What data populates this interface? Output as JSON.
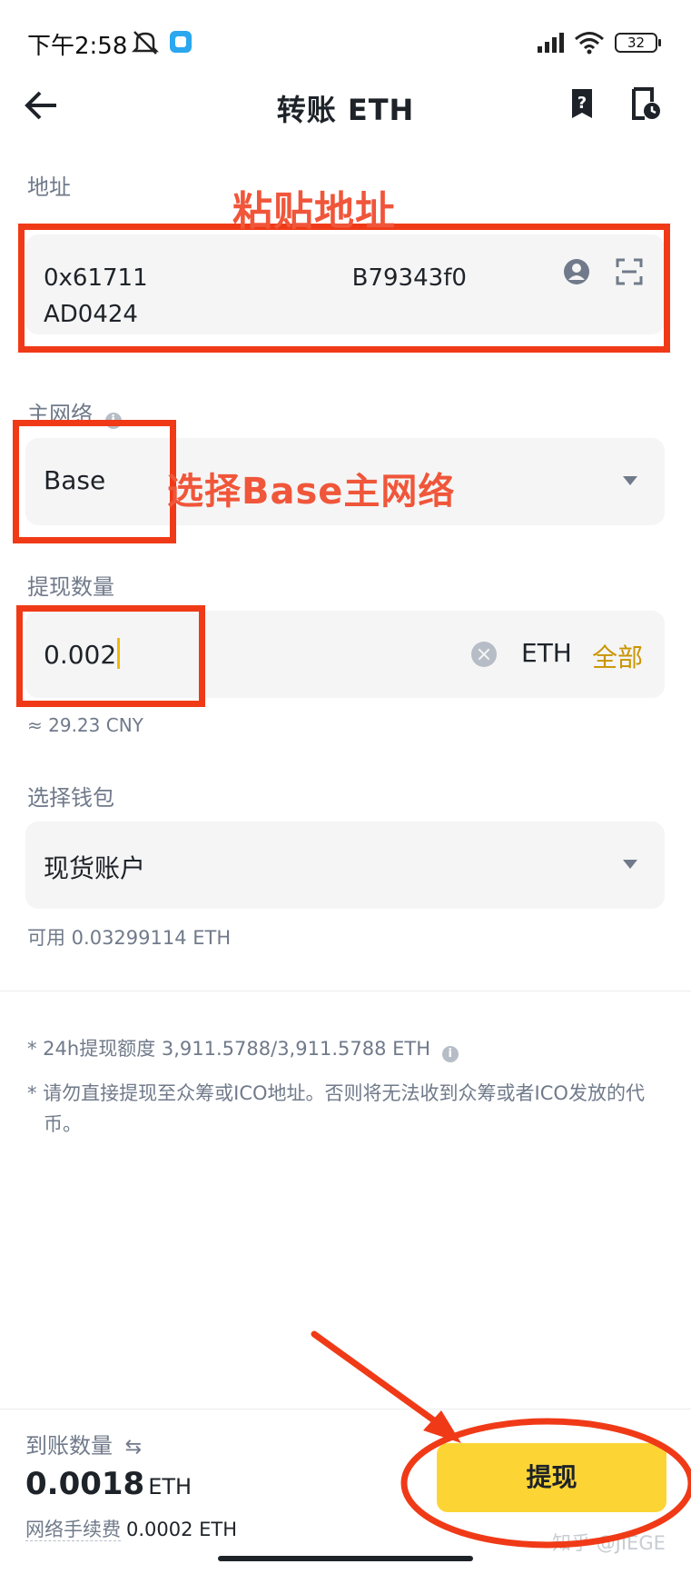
{
  "status_bar": {
    "time": "下午2:58",
    "battery": "32",
    "icons": [
      "mute-icon",
      "app-notification-icon",
      "signal-icon",
      "wifi-icon",
      "battery-icon"
    ]
  },
  "header": {
    "title": "转账 ETH",
    "back_icon": "arrow-left-icon",
    "help_icon": "help-icon",
    "history_icon": "history-icon"
  },
  "address": {
    "label": "地址",
    "value": "0x6171 B79343f0 AD0424",
    "contact_icon": "contact-icon",
    "scan_icon": "scan-icon"
  },
  "network": {
    "label": "主网络",
    "value": "Base",
    "info_icon": "info-icon"
  },
  "amount": {
    "label": "提现数量",
    "value": "0.002",
    "unit": "ETH",
    "max_label": "全部",
    "fiat_estimate": "≈ 29.23 CNY"
  },
  "wallet": {
    "label": "选择钱包",
    "value": "现货账户",
    "available": "可用 0.03299114 ETH"
  },
  "notes": {
    "quota": "* 24h提现额度 3,911.5788/3,911.5788 ETH",
    "ico_warning": "* 请勿直接提现至众筹或ICO地址。否则将无法收到众筹或者ICO发放的代币。"
  },
  "bottom": {
    "receive_label": "到账数量",
    "receive_amount": "0.0018",
    "receive_unit": "ETH",
    "fee_label": "网络手续费",
    "fee_value": "0.0002 ETH",
    "withdraw_button": "提现"
  },
  "annotations": {
    "paste_address": "粘贴地址",
    "select_network": "选择Base主网络"
  },
  "watermark": "知乎 @JIEGE",
  "colors": {
    "accent": "#fcd535",
    "accent_text": "#c99400",
    "annotation": "#f03a17",
    "panel_bg": "#f5f5f5",
    "muted_text": "#707a8a"
  }
}
